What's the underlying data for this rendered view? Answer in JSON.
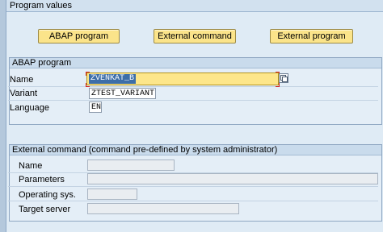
{
  "header": {
    "title": "Program values"
  },
  "buttons": {
    "abap_program": "ABAP program",
    "external_command": "External command",
    "external_program": "External program"
  },
  "abap_group": {
    "title": "ABAP program",
    "name_label": "Name",
    "name_value": "ZVENKAT_B",
    "variant_label": "Variant",
    "variant_value": "ZTEST_VARIANT",
    "language_label": "Language",
    "language_value": "EN"
  },
  "external_group": {
    "title": "External command (command pre-defined by system administrator)",
    "name_label": "Name",
    "parameters_label": "Parameters",
    "operating_sys_label": "Operating sys.",
    "target_server_label": "Target server"
  },
  "colors": {
    "background": "#dfebf5",
    "button_yellow": "#fbe48a",
    "selection": "#3d6ea8"
  },
  "icons": {
    "value_help": "value-help-icon"
  }
}
